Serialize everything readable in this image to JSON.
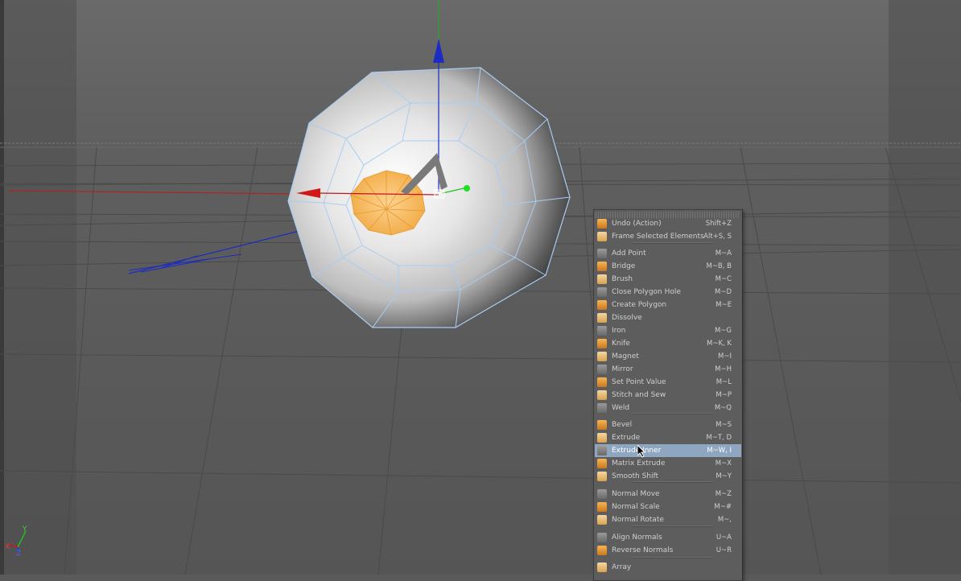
{
  "viewport": {
    "axis_labels": {
      "x": "X",
      "y": "Y",
      "z": "Z"
    }
  },
  "menu": {
    "items": [
      {
        "name": "menu-item-undo-action",
        "label": "Undo (Action)",
        "shortcut": "Shift+Z",
        "icon": "undo-icon"
      },
      {
        "name": "menu-item-frame-selected-elements",
        "label": "Frame Selected Elements",
        "shortcut": "Alt+S, S",
        "icon": "frame-icon"
      },
      {
        "name": "menu-item-add-point",
        "label": "Add Point",
        "shortcut": "M~A",
        "icon": "add-point-icon"
      },
      {
        "name": "menu-item-bridge",
        "label": "Bridge",
        "shortcut": "M~B, B",
        "icon": "bridge-icon"
      },
      {
        "name": "menu-item-brush",
        "label": "Brush",
        "shortcut": "M~C",
        "icon": "brush-icon"
      },
      {
        "name": "menu-item-close-polygon-hole",
        "label": "Close Polygon Hole",
        "shortcut": "M~D",
        "icon": "close-polygon-hole-icon"
      },
      {
        "name": "menu-item-create-polygon",
        "label": "Create Polygon",
        "shortcut": "M~E",
        "icon": "create-polygon-icon"
      },
      {
        "name": "menu-item-dissolve",
        "label": "Dissolve",
        "shortcut": "",
        "icon": "dissolve-icon"
      },
      {
        "name": "menu-item-iron",
        "label": "Iron",
        "shortcut": "M~G",
        "icon": "iron-icon"
      },
      {
        "name": "menu-item-knife",
        "label": "Knife",
        "shortcut": "M~K, K",
        "icon": "knife-icon"
      },
      {
        "name": "menu-item-magnet",
        "label": "Magnet",
        "shortcut": "M~I",
        "icon": "magnet-icon"
      },
      {
        "name": "menu-item-mirror",
        "label": "Mirror",
        "shortcut": "M~H",
        "icon": "mirror-icon"
      },
      {
        "name": "menu-item-set-point-value",
        "label": "Set Point Value",
        "shortcut": "M~L",
        "icon": "set-point-value-icon"
      },
      {
        "name": "menu-item-stitch-and-sew",
        "label": "Stitch and Sew",
        "shortcut": "M~P",
        "icon": "stitch-icon"
      },
      {
        "name": "menu-item-weld",
        "label": "Weld",
        "shortcut": "M~Q",
        "icon": "weld-icon"
      },
      {
        "name": "menu-item-bevel",
        "label": "Bevel",
        "shortcut": "M~S",
        "icon": "bevel-icon"
      },
      {
        "name": "menu-item-extrude",
        "label": "Extrude",
        "shortcut": "M~T, D",
        "icon": "extrude-icon"
      },
      {
        "name": "menu-item-extrude-inner",
        "label": "Extrude Inner",
        "shortcut": "M~W, I",
        "icon": "extrude-inner-icon",
        "selected": true
      },
      {
        "name": "menu-item-matrix-extrude",
        "label": "Matrix Extrude",
        "shortcut": "M~X",
        "icon": "matrix-extrude-icon"
      },
      {
        "name": "menu-item-smooth-shift",
        "label": "Smooth Shift",
        "shortcut": "M~Y",
        "icon": "smooth-shift-icon"
      },
      {
        "name": "menu-item-normal-move",
        "label": "Normal Move",
        "shortcut": "M~Z",
        "icon": "normal-move-icon"
      },
      {
        "name": "menu-item-normal-scale",
        "label": "Normal Scale",
        "shortcut": "M~#",
        "icon": "normal-scale-icon"
      },
      {
        "name": "menu-item-normal-rotate",
        "label": "Normal Rotate",
        "shortcut": "M~,",
        "icon": "normal-rotate-icon"
      },
      {
        "name": "menu-item-align-normals",
        "label": "Align Normals",
        "shortcut": "U~A",
        "icon": "align-normals-icon"
      },
      {
        "name": "menu-item-reverse-normals",
        "label": "Reverse Normals",
        "shortcut": "U~R",
        "icon": "reverse-normals-icon"
      },
      {
        "name": "menu-item-array",
        "label": "Array",
        "shortcut": "",
        "icon": "array-icon"
      }
    ]
  },
  "colors": {
    "selection": "#8ea6bf",
    "menu_bg": "#5d5d5d",
    "polygon_selection": "#f6a73a",
    "wire": "#a9cdf2",
    "x_axis": "#d01818",
    "y_axis": "#20c020",
    "z_axis": "#1c2cc0"
  }
}
